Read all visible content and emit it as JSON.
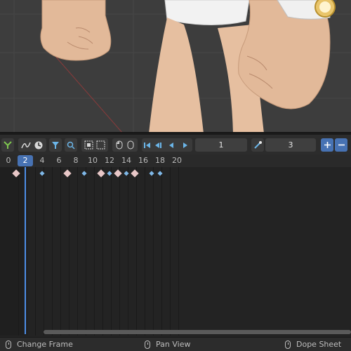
{
  "toolbar": {
    "current_frame": "1",
    "keyframe_step": "3"
  },
  "timeline": {
    "ticks": [
      "0",
      "2",
      "4",
      "6",
      "8",
      "10",
      "12",
      "14",
      "16",
      "18",
      "20"
    ],
    "current_frame_label": "2",
    "keys": [
      {
        "frame": 0.9,
        "type": "big"
      },
      {
        "frame": 4,
        "type": "small"
      },
      {
        "frame": 7,
        "type": "big"
      },
      {
        "frame": 9,
        "type": "small"
      },
      {
        "frame": 11,
        "type": "big"
      },
      {
        "frame": 12,
        "type": "small"
      },
      {
        "frame": 13,
        "type": "big"
      },
      {
        "frame": 14,
        "type": "small"
      },
      {
        "frame": 15,
        "type": "big"
      },
      {
        "frame": 17,
        "type": "small"
      },
      {
        "frame": 18,
        "type": "small"
      }
    ]
  },
  "status": {
    "change_frame": "Change Frame",
    "pan_view": "Pan View",
    "dope_sheet": "Dope Sheet"
  },
  "colors": {
    "accent": "#4772b3",
    "playhead": "#4d8ee6",
    "key_big": "#e8c7c7",
    "key_small": "#7fb8e8"
  }
}
